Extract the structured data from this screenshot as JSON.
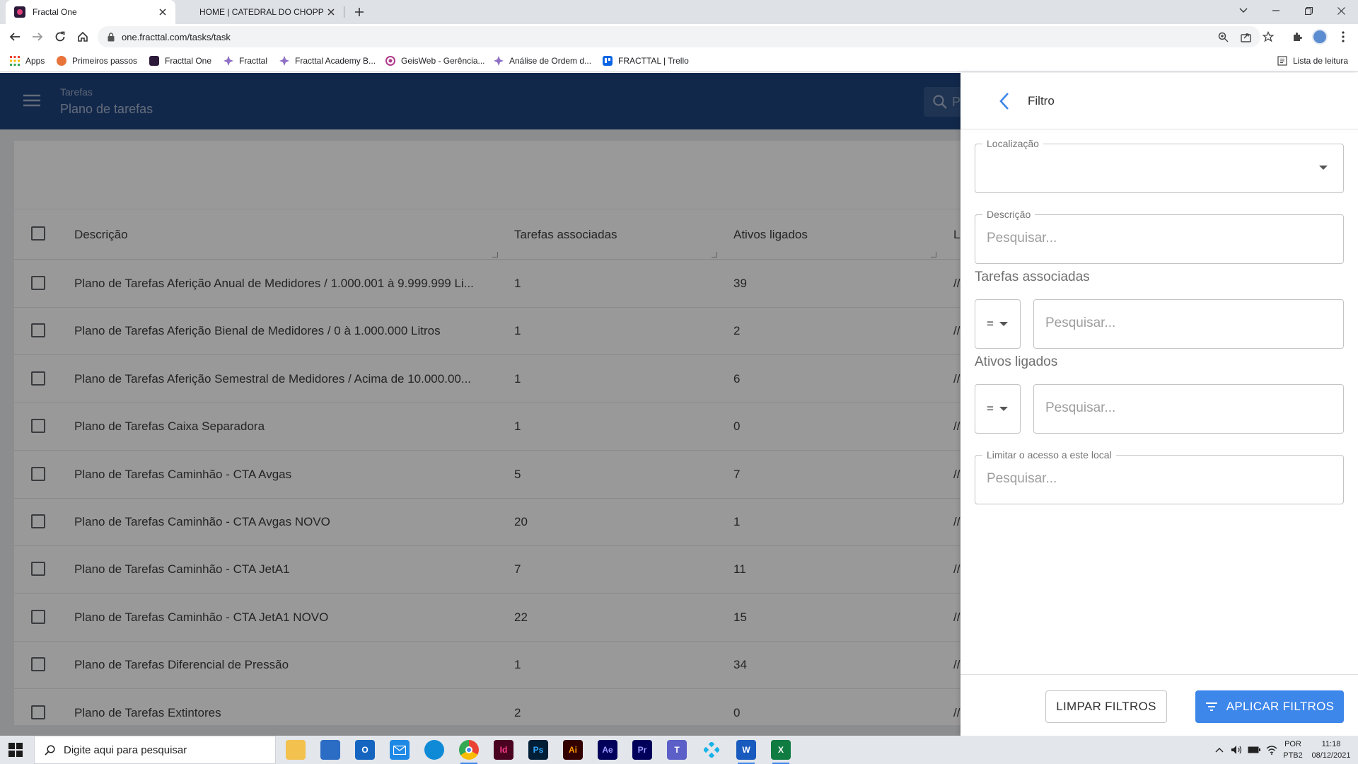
{
  "browser": {
    "tabs": [
      {
        "title": "Fractal One",
        "active": true
      },
      {
        "title": "HOME | CATEDRAL DO CHOPP",
        "active": false
      }
    ],
    "url": "one.fracttal.com/tasks/task",
    "bookmarks": [
      {
        "label": "Apps",
        "color": "#ea4335"
      },
      {
        "label": "Primeiros passos",
        "color": "#e8743b"
      },
      {
        "label": "Fracttal One",
        "color": "#2d1a3a"
      },
      {
        "label": "Fracttal",
        "color": "#7b5ea7"
      },
      {
        "label": "Fracttal Academy B...",
        "color": "#7b5ea7"
      },
      {
        "label": "GeisWeb - Gerência...",
        "color": "#b03a8a"
      },
      {
        "label": "Análise de Ordem d...",
        "color": "#7b5ea7"
      },
      {
        "label": "FRACTTAL | Trello",
        "color": "#0c66e4"
      }
    ],
    "reading_list": "Lista de leitura"
  },
  "header": {
    "section": "Tarefas",
    "page": "Plano de tarefas",
    "search_placeholder": "P"
  },
  "table": {
    "columns": [
      "Descrição",
      "Tarefas associadas",
      "Ativos ligados",
      "L"
    ],
    "rows": [
      {
        "descricao": "Plano de Tarefas Aferição Anual de Medidores / 1.000.001 à 9.999.999 Li...",
        "tarefas": "1",
        "ativos": "39",
        "loc": "//"
      },
      {
        "descricao": "Plano de Tarefas Aferição Bienal de Medidores / 0 à 1.000.000 Litros",
        "tarefas": "1",
        "ativos": "2",
        "loc": "//"
      },
      {
        "descricao": "Plano de Tarefas Aferição Semestral de Medidores / Acima de 10.000.00...",
        "tarefas": "1",
        "ativos": "6",
        "loc": "//"
      },
      {
        "descricao": "Plano de Tarefas Caixa Separadora",
        "tarefas": "1",
        "ativos": "0",
        "loc": "//"
      },
      {
        "descricao": "Plano de Tarefas Caminhão - CTA Avgas",
        "tarefas": "5",
        "ativos": "7",
        "loc": "//"
      },
      {
        "descricao": "Plano de Tarefas Caminhão - CTA Avgas NOVO",
        "tarefas": "20",
        "ativos": "1",
        "loc": "//"
      },
      {
        "descricao": "Plano de Tarefas Caminhão - CTA JetA1",
        "tarefas": "7",
        "ativos": "11",
        "loc": "//"
      },
      {
        "descricao": "Plano de Tarefas Caminhão - CTA JetA1 NOVO",
        "tarefas": "22",
        "ativos": "15",
        "loc": "//"
      },
      {
        "descricao": "Plano de Tarefas Diferencial de Pressão",
        "tarefas": "1",
        "ativos": "34",
        "loc": "//"
      },
      {
        "descricao": "Plano de Tarefas Extintores",
        "tarefas": "2",
        "ativos": "0",
        "loc": "//"
      }
    ]
  },
  "filter": {
    "title": "Filtro",
    "localizacao_label": "Localização",
    "descricao_label": "Descrição",
    "descricao_placeholder": "Pesquisar...",
    "tarefas_label": "Tarefas associadas",
    "tarefas_operator": "=",
    "tarefas_placeholder": "Pesquisar...",
    "ativos_label": "Ativos ligados",
    "ativos_operator": "=",
    "ativos_placeholder": "Pesquisar...",
    "limitar_label": "Limitar o acesso a este local",
    "limitar_placeholder": "Pesquisar...",
    "clear_button": "LIMPAR FILTROS",
    "apply_button": "APLICAR FILTROS"
  },
  "taskbar": {
    "search_placeholder": "Digite aqui para pesquisar",
    "language": "POR",
    "layout": "PTB2",
    "time": "11:18",
    "date": "08/12/2021"
  },
  "colors": {
    "header_blue": "#1f437d",
    "apply_blue": "#3d86ea"
  }
}
